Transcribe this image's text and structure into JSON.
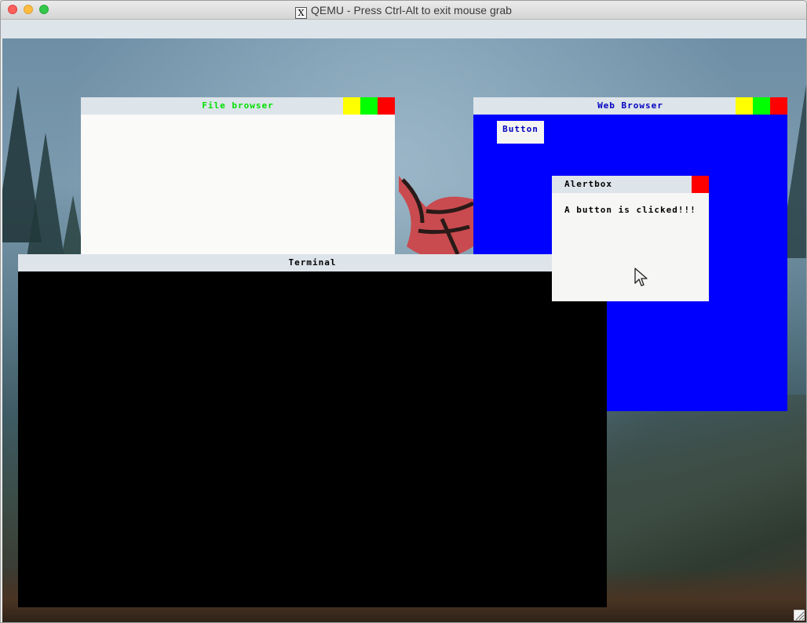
{
  "host_window": {
    "title": "QEMU - Press Ctrl-Alt to exit mouse grab",
    "title_icon": "X"
  },
  "windows": {
    "file_browser": {
      "title": "File browser"
    },
    "web_browser": {
      "title": "Web Browser",
      "button_label": "Button"
    },
    "terminal": {
      "title": "Terminal"
    },
    "alertbox": {
      "title": "Alertbox",
      "message": "A button is clicked!!!"
    }
  },
  "colors": {
    "minimize": "#ffff00",
    "maximize": "#00ff00",
    "close": "#ff0000",
    "web_browser_bg": "#0000ff",
    "file_browser_title": "#00e000",
    "web_browser_title": "#0000c0"
  }
}
